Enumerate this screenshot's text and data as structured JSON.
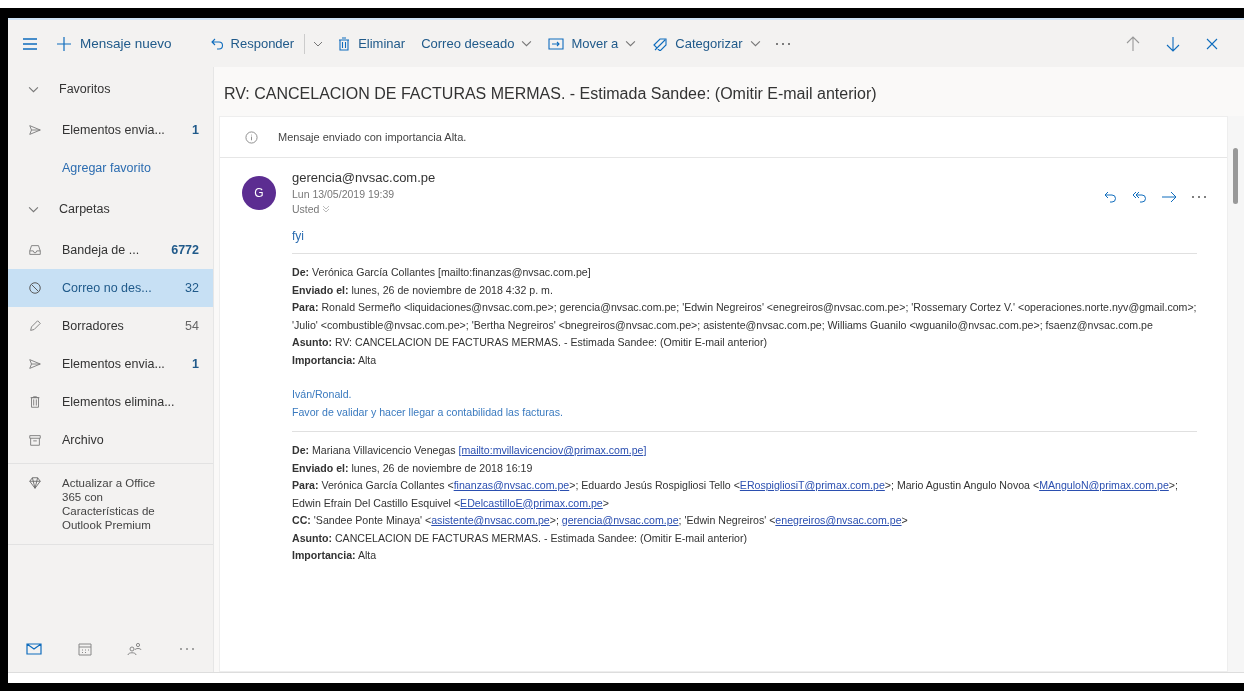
{
  "toolbar": {
    "new_message": "Mensaje nuevo",
    "actions": [
      {
        "label": "Responder",
        "kind": "split"
      },
      {
        "label": "Eliminar",
        "kind": "plain"
      },
      {
        "label": "Correo deseado",
        "kind": "menu"
      },
      {
        "label": "Mover a",
        "kind": "menu"
      },
      {
        "label": "Categorizar",
        "kind": "menu"
      }
    ]
  },
  "sidebar": {
    "favorites_heading": "Favoritos",
    "favorites": [
      {
        "label": "Elementos envia...",
        "count": "1",
        "unread": true,
        "selected": false
      }
    ],
    "add_favorite": "Agregar favorito",
    "folders_heading": "Carpetas",
    "folders": [
      {
        "label": "Bandeja de ...",
        "count": "6772",
        "unread": true,
        "selected": false
      },
      {
        "label": "Correo no des...",
        "count": "32",
        "unread": false,
        "selected": true
      },
      {
        "label": "Borradores",
        "count": "54",
        "unread": false,
        "selected": false
      },
      {
        "label": "Elementos envia...",
        "count": "1",
        "unread": true,
        "selected": false
      },
      {
        "label": "Elementos elimina...",
        "selected": false
      },
      {
        "label": "Archivo",
        "selected": false
      }
    ],
    "upgrade": "Actualizar a Office 365 con Características de Outlook Premium"
  },
  "message": {
    "subject": "RV: CANCELACION DE FACTURAS MERMAS. - Estimada Sandee: (Omitir E-mail anterior)",
    "notice": "Mensaje enviado con importancia Alta.",
    "avatar": "G",
    "sender": "gerencia@nvsac.com.pe",
    "date": "Lun 13/05/2019 19:39",
    "recipient": "Usted",
    "greeting": "fyi",
    "quoted": [
      {
        "headers": [
          {
            "label": "De:",
            "parts": [
              {
                "text": "Verónica García Collantes [mailto:finanzas@nvsac.com.pe]",
                "link": false
              }
            ]
          },
          {
            "label": "Enviado el:",
            "parts": [
              {
                "text": "lunes, 26 de noviembre de 2018 4:32 p. m.",
                "link": false
              }
            ]
          },
          {
            "label": "Para:",
            "parts": [
              {
                "text": "Ronald Sermeño <liquidaciones@nvsac.com.pe>; gerencia@nvsac.com.pe; 'Edwin Negreiros' <enegreiros@nvsac.com.pe>; 'Rossemary Cortez V.' <operaciones.norte.nyv@gmail.com>; 'Julio' <combustible@nvsac.com.pe>; 'Bertha Negreiros' <bnegreiros@nvsac.com.pe>; asistente@nvsac.com.pe; Williams Guanilo <wguanilo@nvsac.com.pe>; fsaenz@nvsac.com.pe",
                "link": false
              }
            ]
          },
          {
            "label": "Asunto:",
            "parts": [
              {
                "text": "RV: CANCELACION DE FACTURAS MERMAS. - Estimada Sandee: (Omitir E-mail anterior)",
                "link": false
              }
            ]
          },
          {
            "label": "Importancia:",
            "parts": [
              {
                "text": "Alta",
                "link": false
              }
            ]
          }
        ],
        "body": [
          "Iván/Ronald.",
          "Favor de validar y hacer llegar a contabilidad las facturas."
        ]
      },
      {
        "headers": [
          {
            "label": "De:",
            "parts": [
              {
                "text": "Mariana Villavicencio Venegas ",
                "link": false
              },
              {
                "text": "[mailto:mvillavicenciov@primax.com.pe]",
                "link": true
              }
            ]
          },
          {
            "label": "Enviado el:",
            "parts": [
              {
                "text": "lunes, 26 de noviembre de 2018 16:19",
                "link": false
              }
            ]
          },
          {
            "label": "Para:",
            "parts": [
              {
                "text": "Verónica García Collantes <",
                "link": false
              },
              {
                "text": "finanzas@nvsac.com.pe",
                "link": true
              },
              {
                "text": ">; Eduardo Jesús Rospigliosi Tello <",
                "link": false
              },
              {
                "text": "ERospigliosiT@primax.com.pe",
                "link": true
              },
              {
                "text": ">; Mario Agustin Angulo Novoa <",
                "link": false
              },
              {
                "text": "MAnguloN@primax.com.pe",
                "link": true
              },
              {
                "text": ">; Edwin Efrain Del Castillo Esquivel <",
                "link": false
              },
              {
                "text": "EDelcastilloE@primax.com.pe",
                "link": true
              },
              {
                "text": ">",
                "link": false
              }
            ]
          },
          {
            "label": "CC:",
            "parts": [
              {
                "text": "'Sandee Ponte Minaya' <",
                "link": false
              },
              {
                "text": "asistente@nvsac.com.pe",
                "link": true
              },
              {
                "text": ">; ",
                "link": false
              },
              {
                "text": "gerencia@nvsac.com.pe",
                "link": true
              },
              {
                "text": "; 'Edwin Negreiros' <",
                "link": false
              },
              {
                "text": "enegreiros@nvsac.com.pe",
                "link": true
              },
              {
                "text": ">",
                "link": false
              }
            ]
          },
          {
            "label": "Asunto:",
            "parts": [
              {
                "text": "CANCELACION DE FACTURAS MERMAS. - Estimada Sandee: (Omitir E-mail anterior)",
                "link": false
              }
            ]
          },
          {
            "label": "Importancia:",
            "parts": [
              {
                "text": "Alta",
                "link": false
              }
            ]
          }
        ]
      }
    ]
  }
}
